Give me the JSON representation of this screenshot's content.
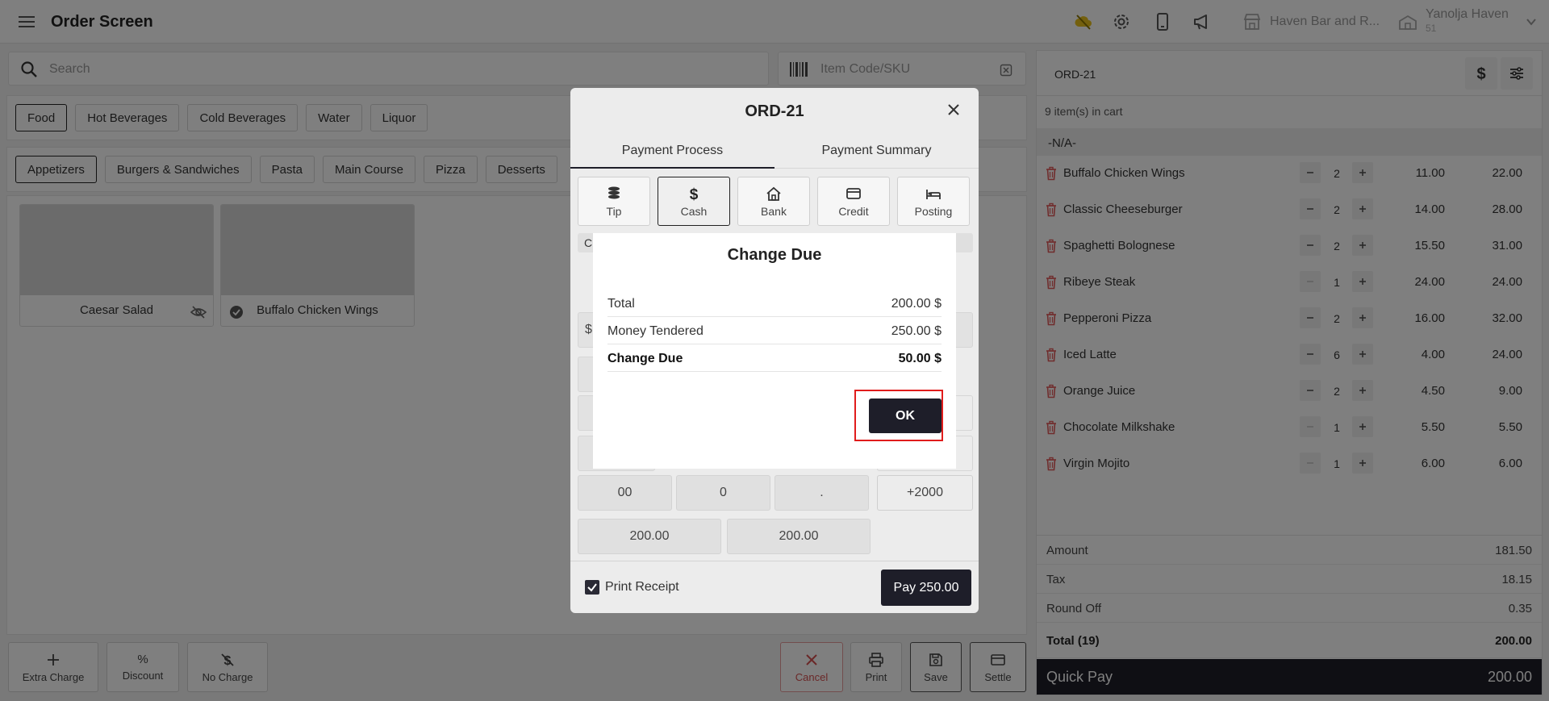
{
  "app": {
    "title": "Order Screen"
  },
  "topbar": {
    "store_name": "Haven Bar and R...",
    "user_name": "Yanolja Haven",
    "user_sub": "51"
  },
  "search": {
    "placeholder": "Search"
  },
  "sku": {
    "placeholder": "Item Code/SKU"
  },
  "categories": [
    "Food",
    "Hot Beverages",
    "Cold Beverages",
    "Water",
    "Liquor"
  ],
  "subcategories": [
    "Appetizers",
    "Burgers & Sandwiches",
    "Pasta",
    "Main Course",
    "Pizza",
    "Desserts"
  ],
  "products": [
    {
      "name": "Caesar Salad"
    },
    {
      "name": "Buffalo Chicken Wings"
    }
  ],
  "bottom_actions": {
    "extra_charge": "Extra Charge",
    "discount_symbol": "%",
    "discount": "Discount",
    "no_charge": "No Charge",
    "cancel": "Cancel",
    "print": "Print",
    "save": "Save",
    "settle": "Settle"
  },
  "cart": {
    "order_id": "ORD-21",
    "count_label": "9 item(s) in cart",
    "group": "-N/A-",
    "items": [
      {
        "name": "Buffalo Chicken Wings",
        "qty": "2",
        "price": "11.00",
        "amount": "22.00"
      },
      {
        "name": "Classic Cheeseburger",
        "qty": "2",
        "price": "14.00",
        "amount": "28.00"
      },
      {
        "name": "Spaghetti Bolognese",
        "qty": "2",
        "price": "15.50",
        "amount": "31.00"
      },
      {
        "name": "Ribeye Steak",
        "qty": "1",
        "price": "24.00",
        "amount": "24.00"
      },
      {
        "name": "Pepperoni Pizza",
        "qty": "2",
        "price": "16.00",
        "amount": "32.00"
      },
      {
        "name": "Iced Latte",
        "qty": "6",
        "price": "4.00",
        "amount": "24.00"
      },
      {
        "name": "Orange Juice",
        "qty": "2",
        "price": "4.50",
        "amount": "9.00"
      },
      {
        "name": "Chocolate Milkshake",
        "qty": "1",
        "price": "5.50",
        "amount": "5.50"
      },
      {
        "name": "Virgin Mojito",
        "qty": "1",
        "price": "6.00",
        "amount": "6.00"
      }
    ],
    "amount_label": "Amount",
    "amount": "181.50",
    "tax_label": "Tax",
    "tax": "18.15",
    "round_label": "Round Off",
    "round": "0.35",
    "total_label": "Total (19)",
    "total": "200.00",
    "quick_pay_label": "Quick Pay",
    "quick_pay": "200.00"
  },
  "payment_modal": {
    "title": "ORD-21",
    "tabs": [
      "Payment Process",
      "Payment Summary"
    ],
    "methods": [
      "Tip",
      "Cash",
      "Bank",
      "Credit",
      "Posting"
    ],
    "strip_char": "C",
    "amount_prefix": "$",
    "keys": [
      "00",
      "0",
      ".",
      "+2000"
    ],
    "quick_amounts": [
      "200.00",
      "200.00"
    ],
    "print_receipt": "Print Receipt",
    "pay_button": "Pay 250.00"
  },
  "change_due": {
    "title": "Change Due",
    "total_label": "Total",
    "total": "200.00 $",
    "tendered_label": "Money Tendered",
    "tendered": "250.00 $",
    "change_label": "Change Due",
    "change": "50.00 $",
    "ok": "OK"
  }
}
